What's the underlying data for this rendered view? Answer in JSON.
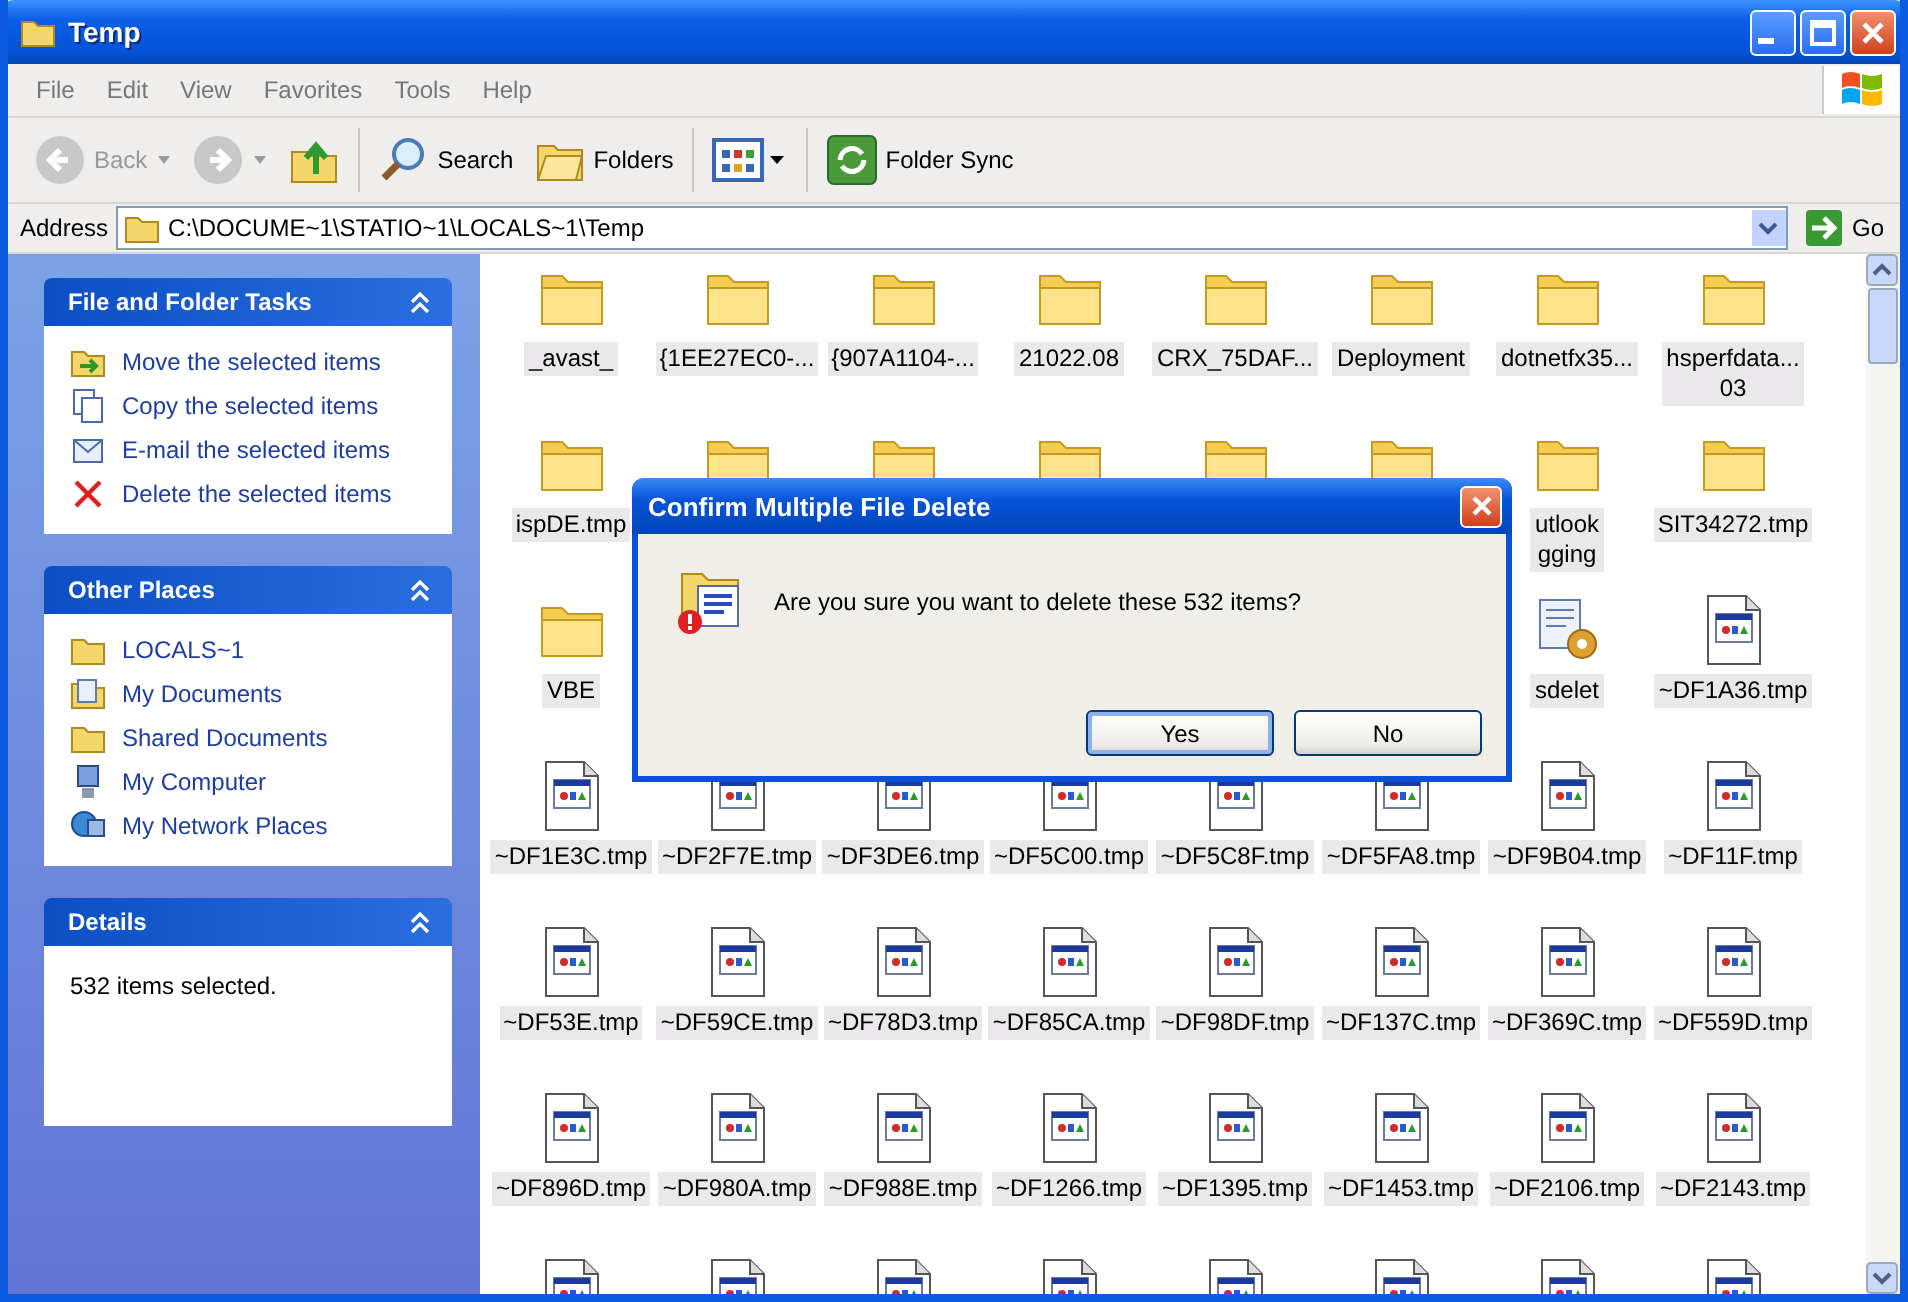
{
  "window": {
    "title": "Temp"
  },
  "menu": [
    "File",
    "Edit",
    "View",
    "Favorites",
    "Tools",
    "Help"
  ],
  "toolbar": [
    {
      "kind": "back",
      "label": "Back",
      "disabled": true
    },
    {
      "kind": "forward",
      "disabled": true
    },
    {
      "kind": "up",
      "disabled": false
    },
    {
      "kind": "search",
      "label": "Search"
    },
    {
      "kind": "folders",
      "label": "Folders"
    },
    {
      "kind": "views"
    },
    {
      "kind": "sync",
      "label": "Folder Sync"
    }
  ],
  "address": {
    "label": "Address",
    "value": "C:\\DOCUME~1\\STATIO~1\\LOCALS~1\\Temp",
    "go": "Go"
  },
  "panels": [
    {
      "title": "File and Folder Tasks",
      "items": [
        {
          "kind": "move",
          "label": "Move the selected items"
        },
        {
          "kind": "copy",
          "label": "Copy the selected items"
        },
        {
          "kind": "email",
          "label": "E-mail the selected items"
        },
        {
          "kind": "delete",
          "label": "Delete the selected items"
        }
      ]
    },
    {
      "title": "Other Places",
      "items": [
        {
          "kind": "folder",
          "label": "LOCALS~1"
        },
        {
          "kind": "documents",
          "label": "My Documents"
        },
        {
          "kind": "folder",
          "label": "Shared Documents"
        },
        {
          "kind": "computer",
          "label": "My Computer"
        },
        {
          "kind": "network",
          "label": "My Network Places"
        }
      ]
    },
    {
      "title": "Details",
      "text": "532 items selected."
    }
  ],
  "files": [
    {
      "kind": "folder",
      "label": "_avast_",
      "selected": true
    },
    {
      "kind": "folder",
      "label": "{1EE27EC0-...",
      "selected": true
    },
    {
      "kind": "folder",
      "label": "{907A1104-...",
      "selected": true
    },
    {
      "kind": "folder",
      "label": "21022.08",
      "selected": true
    },
    {
      "kind": "folder",
      "label": "CRX_75DAF...",
      "selected": true
    },
    {
      "kind": "folder",
      "label": "Deployment",
      "selected": true
    },
    {
      "kind": "folder",
      "label": "dotnetfx35...",
      "selected": true
    },
    {
      "kind": "folder",
      "label": "hsperfdata...\n03",
      "selected": true
    },
    {
      "kind": "folder",
      "label": "ispDE.tmp",
      "selected": true
    },
    {
      "kind": "folder"
    },
    {
      "kind": "folder"
    },
    {
      "kind": "folder"
    },
    {
      "kind": "folder"
    },
    {
      "kind": "folder"
    },
    {
      "kind": "folder",
      "label": "utlook\ngging",
      "selected": true
    },
    {
      "kind": "folder",
      "label": "SIT34272.tmp",
      "selected": true
    },
    {
      "kind": "folder",
      "label": "VBE",
      "selected": true
    },
    {
      "kind": "covered"
    },
    {
      "kind": "covered"
    },
    {
      "kind": "covered"
    },
    {
      "kind": "covered"
    },
    {
      "kind": "covered"
    },
    {
      "kind": "app",
      "label": "sdelet",
      "selected": true
    },
    {
      "kind": "tmp",
      "label": "~DF1A36.tmp",
      "selected": true
    },
    {
      "kind": "tmp",
      "label": "~DF1E3C.tmp",
      "selected": true
    },
    {
      "kind": "tmp",
      "label": "~DF2F7E.tmp",
      "selected": true
    },
    {
      "kind": "tmp",
      "label": "~DF3DE6.tmp",
      "selected": true
    },
    {
      "kind": "tmp",
      "label": "~DF5C00.tmp",
      "selected": true
    },
    {
      "kind": "tmp",
      "label": "~DF5C8F.tmp",
      "selected": true
    },
    {
      "kind": "tmp",
      "label": "~DF5FA8.tmp",
      "selected": true
    },
    {
      "kind": "tmp",
      "label": "~DF9B04.tmp",
      "selected": true
    },
    {
      "kind": "tmp",
      "label": "~DF11F.tmp",
      "selected": true
    },
    {
      "kind": "tmp",
      "label": "~DF53E.tmp",
      "selected": true
    },
    {
      "kind": "tmp",
      "label": "~DF59CE.tmp",
      "selected": true
    },
    {
      "kind": "tmp",
      "label": "~DF78D3.tmp",
      "selected": true
    },
    {
      "kind": "tmp",
      "label": "~DF85CA.tmp",
      "selected": true
    },
    {
      "kind": "tmp",
      "label": "~DF98DF.tmp",
      "selected": true
    },
    {
      "kind": "tmp",
      "label": "~DF137C.tmp",
      "selected": true
    },
    {
      "kind": "tmp",
      "label": "~DF369C.tmp",
      "selected": true
    },
    {
      "kind": "tmp",
      "label": "~DF559D.tmp",
      "selected": true
    },
    {
      "kind": "tmp",
      "label": "~DF896D.tmp",
      "selected": true
    },
    {
      "kind": "tmp",
      "label": "~DF980A.tmp",
      "selected": true
    },
    {
      "kind": "tmp",
      "label": "~DF988E.tmp",
      "selected": true
    },
    {
      "kind": "tmp",
      "label": "~DF1266.tmp",
      "selected": true
    },
    {
      "kind": "tmp",
      "label": "~DF1395.tmp",
      "selected": true
    },
    {
      "kind": "tmp",
      "label": "~DF1453.tmp",
      "selected": true
    },
    {
      "kind": "tmp",
      "label": "~DF2106.tmp",
      "selected": true
    },
    {
      "kind": "tmp",
      "label": "~DF2143.tmp",
      "selected": true
    },
    {
      "kind": "tmp"
    },
    {
      "kind": "tmp"
    },
    {
      "kind": "tmp"
    },
    {
      "kind": "tmp"
    },
    {
      "kind": "tmp"
    },
    {
      "kind": "tmp"
    },
    {
      "kind": "tmp"
    },
    {
      "kind": "tmp"
    }
  ],
  "dialog": {
    "title": "Confirm Multiple File Delete",
    "message": "Are you sure you want to delete these 532 items?",
    "buttons": [
      {
        "label": "Yes",
        "selected": true
      },
      {
        "label": "No",
        "selected": false
      }
    ]
  }
}
